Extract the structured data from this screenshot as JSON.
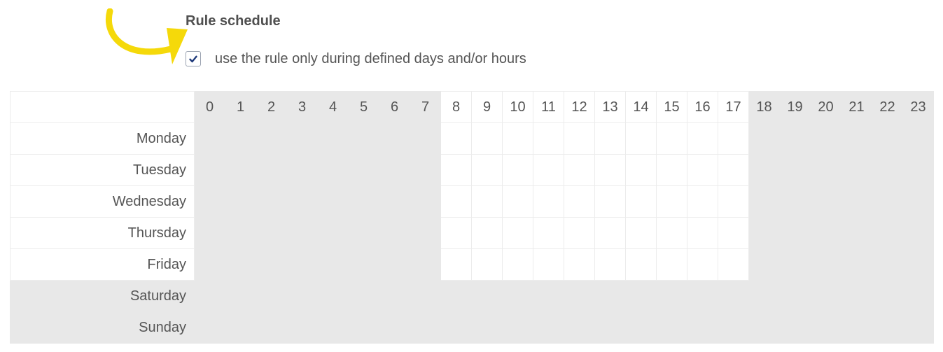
{
  "title": "Rule schedule",
  "checkbox": {
    "label": "use the rule only during defined days and/or hours",
    "checked": true
  },
  "colors": {
    "arrow": "#f5d90a",
    "check": "#1f3a7a",
    "inactive": "#e8e8e8",
    "active": "#ffffff"
  },
  "hours": [
    "0",
    "1",
    "2",
    "3",
    "4",
    "5",
    "6",
    "7",
    "8",
    "9",
    "10",
    "11",
    "12",
    "13",
    "14",
    "15",
    "16",
    "17",
    "18",
    "19",
    "20",
    "21",
    "22",
    "23"
  ],
  "active_hours": [
    8,
    9,
    10,
    11,
    12,
    13,
    14,
    15,
    16,
    17
  ],
  "days": [
    {
      "label": "Monday",
      "active": true
    },
    {
      "label": "Tuesday",
      "active": true
    },
    {
      "label": "Wednesday",
      "active": true
    },
    {
      "label": "Thursday",
      "active": true
    },
    {
      "label": "Friday",
      "active": true
    },
    {
      "label": "Saturday",
      "active": false
    },
    {
      "label": "Sunday",
      "active": false
    }
  ]
}
